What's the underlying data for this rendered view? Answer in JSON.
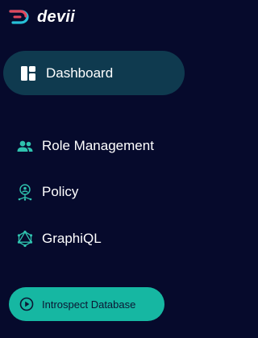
{
  "brand": {
    "name": "devii",
    "logo_icon": "devii-logo-icon",
    "colors": {
      "mark_top": "#e0475d",
      "mark_bottom": "#27c0d8"
    }
  },
  "sidebar": {
    "items": [
      {
        "label": "Dashboard",
        "icon": "dashboard-icon",
        "active": true
      },
      {
        "label": "Role Management",
        "icon": "users-icon",
        "active": false
      },
      {
        "label": "Policy",
        "icon": "policy-icon",
        "active": false
      },
      {
        "label": "GraphiQL",
        "icon": "graphql-icon",
        "active": false
      }
    ],
    "action_button": {
      "label": "Introspect Database",
      "icon": "play-circle-icon"
    }
  },
  "colors": {
    "background": "#060a2c",
    "active_item_bg": "#0f3a4f",
    "accent": "#16b7a2",
    "icon_teal": "#2fc2ae"
  }
}
